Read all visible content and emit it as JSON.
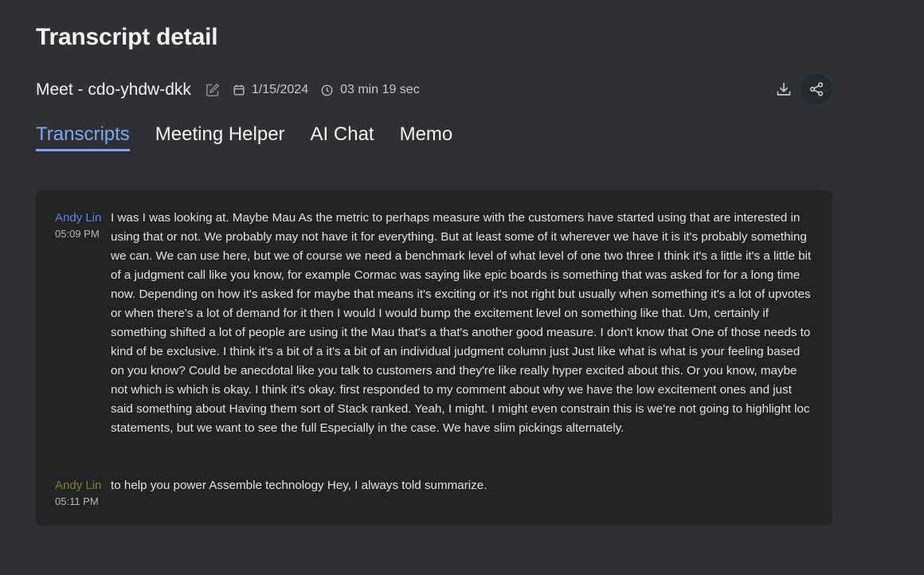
{
  "page": {
    "title": "Transcript detail"
  },
  "meeting": {
    "name": "Meet - cdo-yhdw-dkk",
    "date": "1/15/2024",
    "duration": "03 min 19 sec"
  },
  "tabs": [
    {
      "label": "Transcripts",
      "active": true
    },
    {
      "label": "Meeting Helper",
      "active": false
    },
    {
      "label": "AI Chat",
      "active": false
    },
    {
      "label": "Memo",
      "active": false
    }
  ],
  "transcript": {
    "entries": [
      {
        "speaker": "Andy Lin",
        "speaker_color": "#5b86e5",
        "time": "05:09 PM",
        "text": "I was I was looking at. Maybe Mau As the metric to perhaps measure with the customers have started using that are interested in using that or not. We probably may not have it for everything. But at least some of it wherever we have it is it's probably something we can. We can use here, but we of course we need a benchmark level of what level of one two three I think it's a little it's a little bit of a judgment call like you know, for example Cormac was saying like epic boards is something that was asked for for a long time now. Depending on how it's asked for maybe that means it's exciting or it's not right but usually when something it's a lot of upvotes or when there's a lot of demand for it then I would I would bump the excitement level on something like that. Um, certainly if something shifted a lot of people are using it the Mau that's a that's another good measure. I don't know that One of those needs to kind of be exclusive. I think it's a bit of a it's a bit of an individual judgment column just Just like what is what is your feeling based on you know? Could be anecdotal like you talk to customers and they're like really hyper excited about this. Or you know, maybe not which is which is okay. I think it's okay. first responded to my comment about why we have the low excitement ones and just said something about Having them sort of Stack ranked. Yeah, I might. I might even constrain this is we're not going to highlight loc statements, but we want to see the full Especially in the case. We have slim pickings alternately."
      },
      {
        "speaker": "Andy Lin",
        "speaker_color": "#8a7d2a",
        "time": "05:11 PM",
        "text": "to help you power Assemble technology Hey, I always told summarize."
      }
    ]
  },
  "icons": {
    "edit": "edit-icon",
    "calendar": "calendar-icon",
    "clock": "clock-icon",
    "download": "download-icon",
    "share": "share-icon"
  },
  "colors": {
    "accent": "#79a9f2",
    "background": "#2f3033",
    "card": "#222325"
  }
}
